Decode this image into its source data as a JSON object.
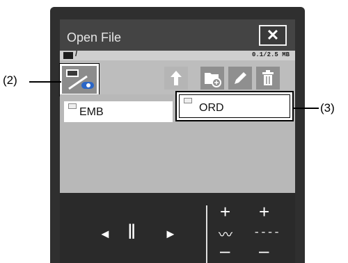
{
  "window": {
    "title": "Open File",
    "close_label": "✕"
  },
  "pathbar": {
    "path": "/",
    "memory": "0.1/2.5 MB"
  },
  "toolbar": {
    "buttons": [
      {
        "name": "up-folder",
        "icon": "up-arrow-icon"
      },
      {
        "name": "new-folder",
        "icon": "new-folder-icon"
      },
      {
        "name": "rename",
        "icon": "pencil-icon"
      },
      {
        "name": "delete",
        "icon": "trash-icon"
      }
    ]
  },
  "media": {
    "icon": "usb-media-icon"
  },
  "files": [
    {
      "label": "EMB",
      "selected": false
    },
    {
      "label": "ORD",
      "selected": true
    }
  ],
  "callouts": {
    "left": "(2)",
    "right": "(3)"
  },
  "controls": {
    "prev": "◄",
    "pause": "‖",
    "next": "►",
    "plus": "+",
    "minus": "–",
    "wave": "〰",
    "dash": "----"
  },
  "colors": {
    "bezel": "#2f2f2f",
    "screen_bg": "#b8b8b8",
    "highlight": "#ffffff"
  }
}
